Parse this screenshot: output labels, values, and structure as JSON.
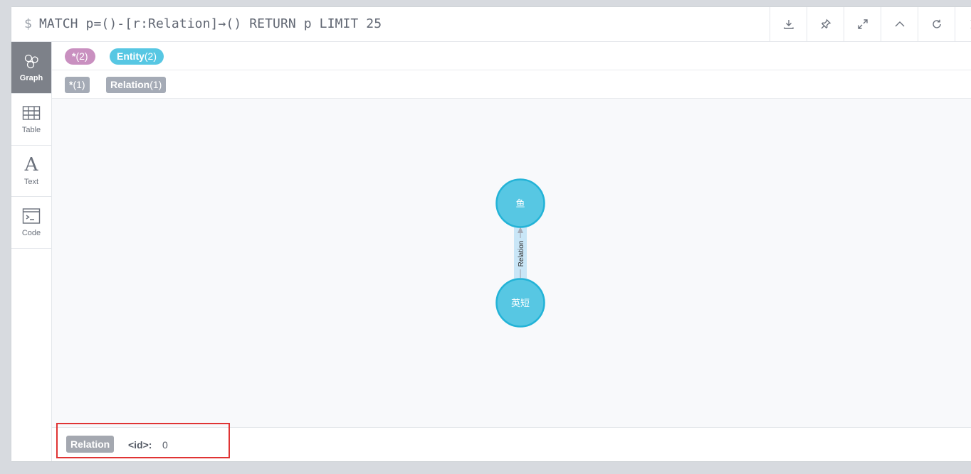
{
  "editor": {
    "prompt": "$",
    "query": "MATCH p=()-[r:Relation]→() RETURN p LIMIT 25",
    "toolbar": [
      "download-icon",
      "pin-icon",
      "expand-icon",
      "collapse-up-icon",
      "rerun-icon",
      "close-icon"
    ]
  },
  "sidebar": {
    "tabs": [
      {
        "label": "Graph",
        "icon": "graph-icon",
        "active": true
      },
      {
        "label": "Table",
        "icon": "table-icon",
        "active": false
      },
      {
        "label": "Text",
        "icon": "text-icon",
        "active": false
      },
      {
        "label": "Code",
        "icon": "code-icon",
        "active": false
      }
    ]
  },
  "legend": {
    "node_labels": [
      {
        "name": "*",
        "count": "(2)",
        "color": "#c990c0"
      },
      {
        "name": "Entity",
        "count": "(2)",
        "color": "#57c7e3"
      }
    ],
    "relationship_types": [
      {
        "name": "*",
        "count": "(1)",
        "color": "#a5abb6"
      },
      {
        "name": "Relation",
        "count": "(1)",
        "color": "#a5abb6"
      }
    ]
  },
  "graph": {
    "nodes": [
      {
        "id": "top",
        "caption": "鱼",
        "color": "#57c7e3",
        "stroke": "#23b3d7"
      },
      {
        "id": "bottom",
        "caption": "英短",
        "color": "#57c7e3",
        "stroke": "#23b3d7"
      }
    ],
    "relationship": {
      "type": "Relation",
      "from": "bottom",
      "to": "top",
      "selected": true,
      "highlight_color": "#c9e6f7"
    }
  },
  "status": {
    "type_label": "Relation",
    "property_key": "<id>:",
    "property_value": "0",
    "highlight_color": "#e03434"
  }
}
